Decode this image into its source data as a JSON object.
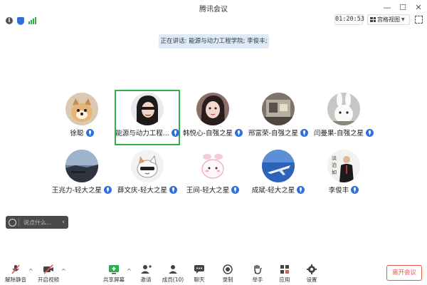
{
  "window": {
    "title": "腾讯会议"
  },
  "info": {
    "timer": "01:20:53",
    "view_label": "宫格视图"
  },
  "speaking_banner": "正在讲话: 能源与动力工程学院; 李俊丰;",
  "participants": [
    {
      "name": "徐聪",
      "avatar": "dog-photo"
    },
    {
      "name": "能源与动力工程...",
      "avatar": "girl-portrait",
      "selected": true
    },
    {
      "name": "韩悦心-自强之星",
      "avatar": "girl-photo"
    },
    {
      "name": "邢富荣-自强之星",
      "avatar": "room-photo"
    },
    {
      "name": "闫曼果-自强之星",
      "avatar": "bunny-photo"
    },
    {
      "name": "王兆力-轻大之星",
      "avatar": "sky-photo"
    },
    {
      "name": "薛文庆-轻大之星",
      "avatar": "cat-cartoon"
    },
    {
      "name": "王间-轻大之星",
      "avatar": "bunny-cartoon"
    },
    {
      "name": "成斌-轻大之星",
      "avatar": "airplane-photo"
    },
    {
      "name": "李俊丰",
      "avatar": "man-portrait"
    }
  ],
  "chat": {
    "placeholder": "说点什么..."
  },
  "toolbar": {
    "mute": "解除静音",
    "video": "开启视频",
    "share": "共享屏幕",
    "invite": "邀请",
    "members": "成员(10)",
    "chat": "聊天",
    "record": "录制",
    "raise": "举手",
    "apps": "应用",
    "settings": "设置"
  },
  "leave_label": "离开会议",
  "colors": {
    "accent": "#2f6fe0",
    "selected_border": "#2cb24c",
    "leave": "#e05a50",
    "banner": "#dfeaf6"
  }
}
